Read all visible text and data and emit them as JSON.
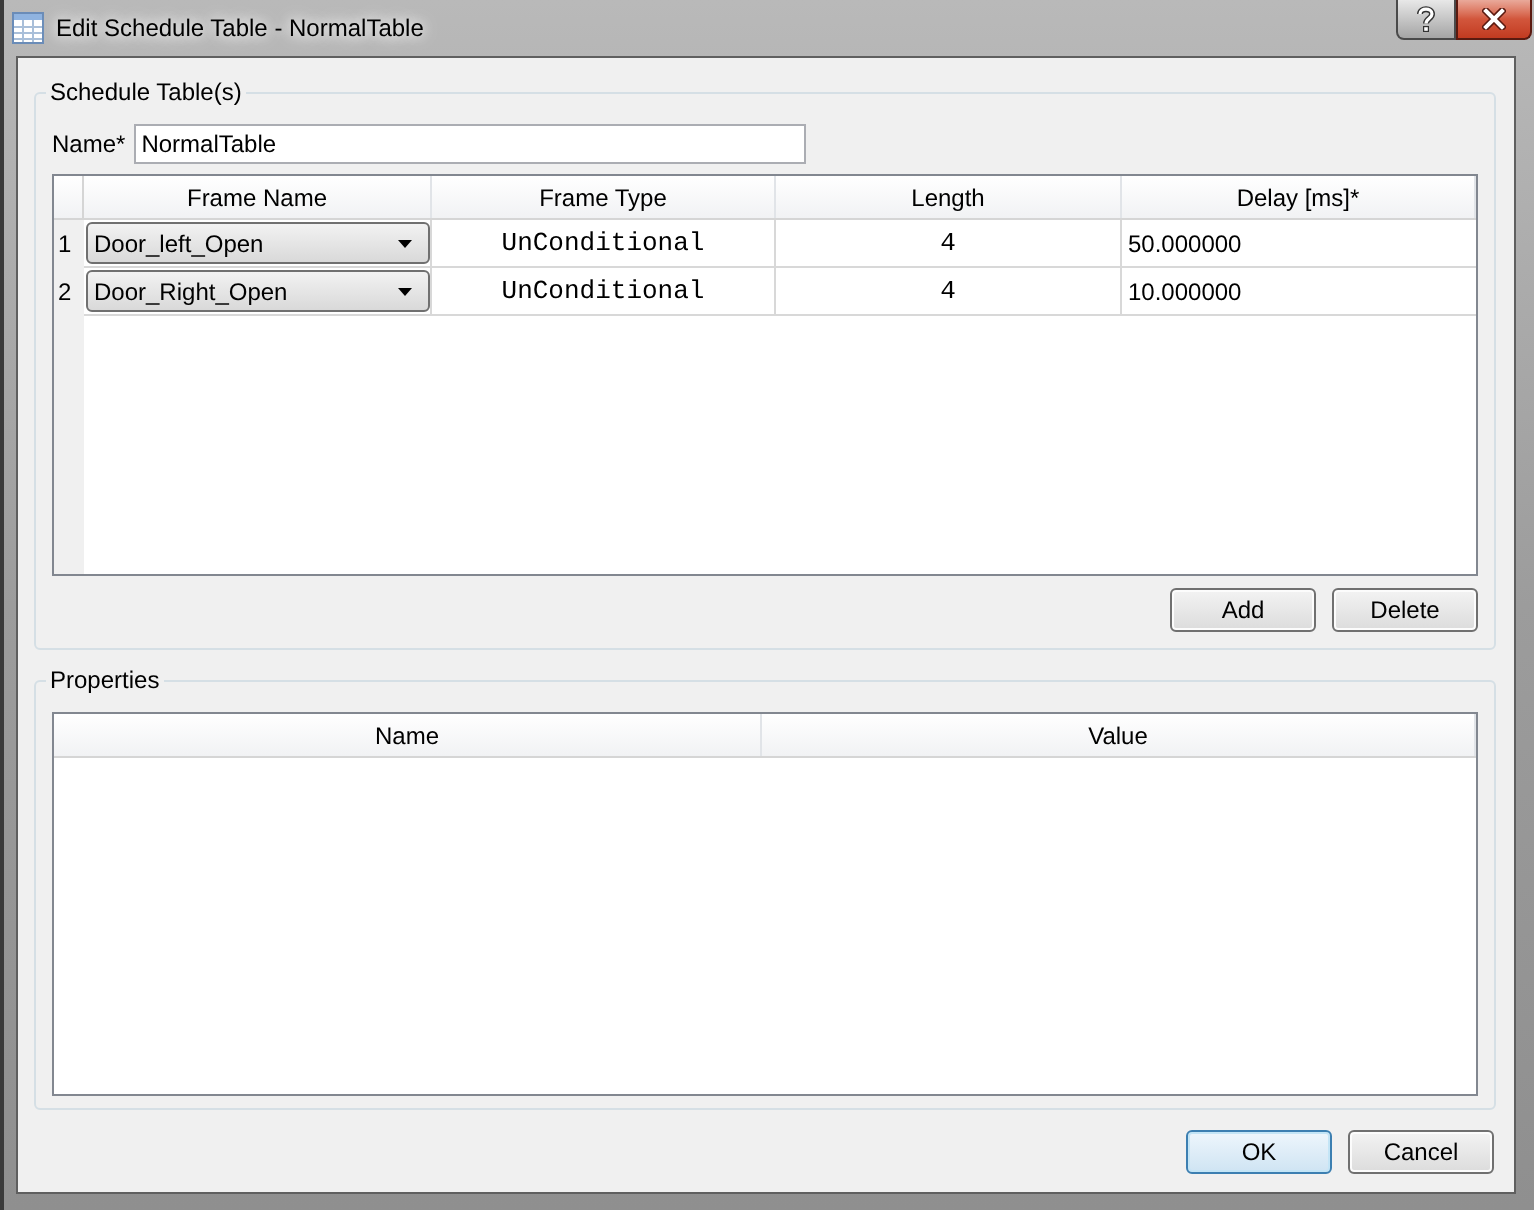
{
  "window": {
    "title": "Edit Schedule Table - NormalTable",
    "buttons": [
      {
        "kind": "help"
      },
      {
        "kind": "close"
      }
    ]
  },
  "schedule_group": {
    "title": "Schedule Table(s)",
    "name_field": {
      "label": "Name*",
      "value": "NormalTable"
    },
    "table": {
      "columns": [
        "Frame Name",
        "Frame Type",
        "Length",
        "Delay [ms]*"
      ],
      "rows": [
        {
          "row_number": "1",
          "frame_name": "Door_left_Open",
          "frame_type": "UnConditional",
          "length": "4",
          "delay": "50.000000"
        },
        {
          "row_number": "2",
          "frame_name": "Door_Right_Open",
          "frame_type": "UnConditional",
          "length": "4",
          "delay": "10.000000"
        }
      ]
    },
    "buttons": [
      "Add",
      "Delete"
    ]
  },
  "properties_group": {
    "title": "Properties",
    "table": {
      "columns": [
        "Name",
        "Value"
      ]
    }
  },
  "dialog_buttons": [
    {
      "label": "OK",
      "focused": true
    },
    {
      "label": "Cancel",
      "focused": false
    }
  ]
}
